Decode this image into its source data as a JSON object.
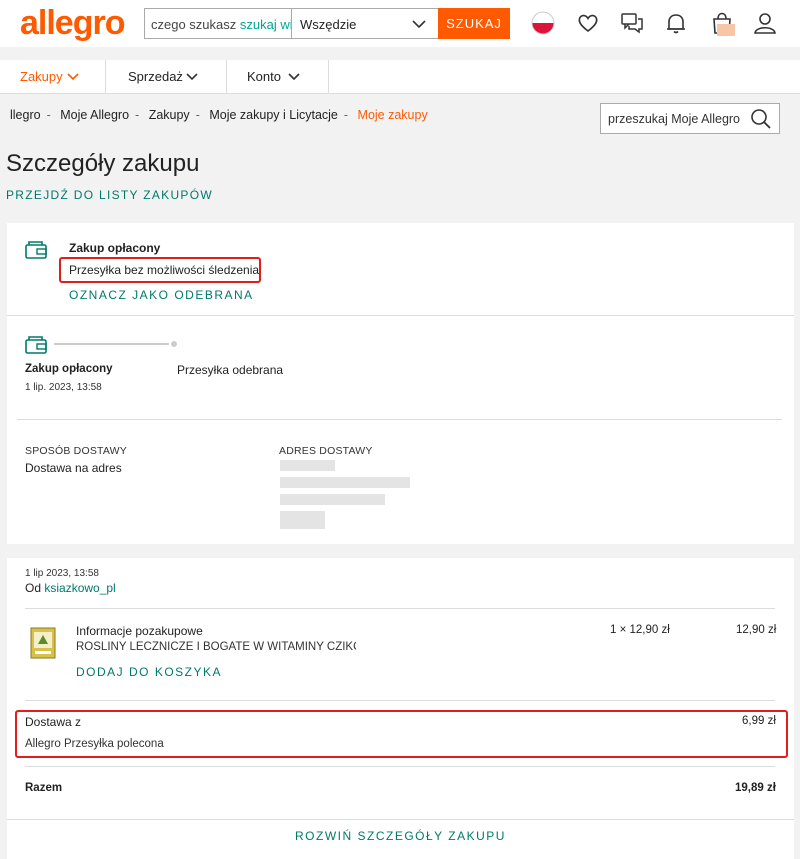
{
  "header": {
    "logo": "allegro",
    "search_value": "czego szukasz",
    "search_hint": "szukaj wielu",
    "scope_selected": "Wszędzie",
    "search_button": "SZUKAJ",
    "icons": [
      "flag-pl-icon",
      "heart-icon",
      "messages-icon",
      "bell-icon",
      "cart-icon",
      "user-icon"
    ]
  },
  "nav": {
    "items": [
      {
        "label": "Zakupy"
      },
      {
        "label": "Sprzedaż"
      },
      {
        "label": "Konto"
      }
    ]
  },
  "breadcrumb": {
    "items": [
      "llegro",
      "Moje Allegro",
      "Zakupy",
      "Moje zakupy i Licytacje"
    ],
    "current": "Moje zakupy"
  },
  "my_search": {
    "placeholder": "przeszukaj Moje Allegro"
  },
  "page": {
    "title": "Szczegóły zakupu",
    "back_link": "PRZEJDŹ DO LISTY ZAKUPÓW"
  },
  "status_card": {
    "title": "Zakup opłacony",
    "subtitle": "Przesyłka bez możliwości śledzenia",
    "action": "OZNACZ JAKO ODEBRANA"
  },
  "timeline": {
    "step1_title": "Zakup opłacony",
    "step1_date": "1 lip. 2023, 13:58",
    "step2_title": "Przesyłka odebrana"
  },
  "delivery": {
    "method_label": "SPOSÓB DOSTAWY",
    "method_value": "Dostawa na adres",
    "address_label": "ADRES DOSTAWY"
  },
  "order": {
    "date": "1 lip 2023, 13:58",
    "from_label": "Od",
    "seller": "ksiazkowo_pl",
    "item_title": "Informacje pozakupowe",
    "item_name": "ROŚLINY LECZNICZE I BOGATE W WITAMINY CZIKOWS",
    "item_qty_price": "1 × 12,90 zł",
    "item_total": "12,90 zł",
    "add_to_cart": "DODAJ DO KOSZYKA",
    "shipping_label": "Dostawa z",
    "shipping_method": "Allegro Przesyłka polecona",
    "shipping_price": "6,99 zł",
    "total_label": "Razem",
    "total_value": "19,89 zł",
    "expand": "ROZWIŃ SZCZEGÓŁY ZAKUPU"
  },
  "colors": {
    "brand": "#ff5a00",
    "teal": "#00796b",
    "highlight": "#e01e1e"
  }
}
